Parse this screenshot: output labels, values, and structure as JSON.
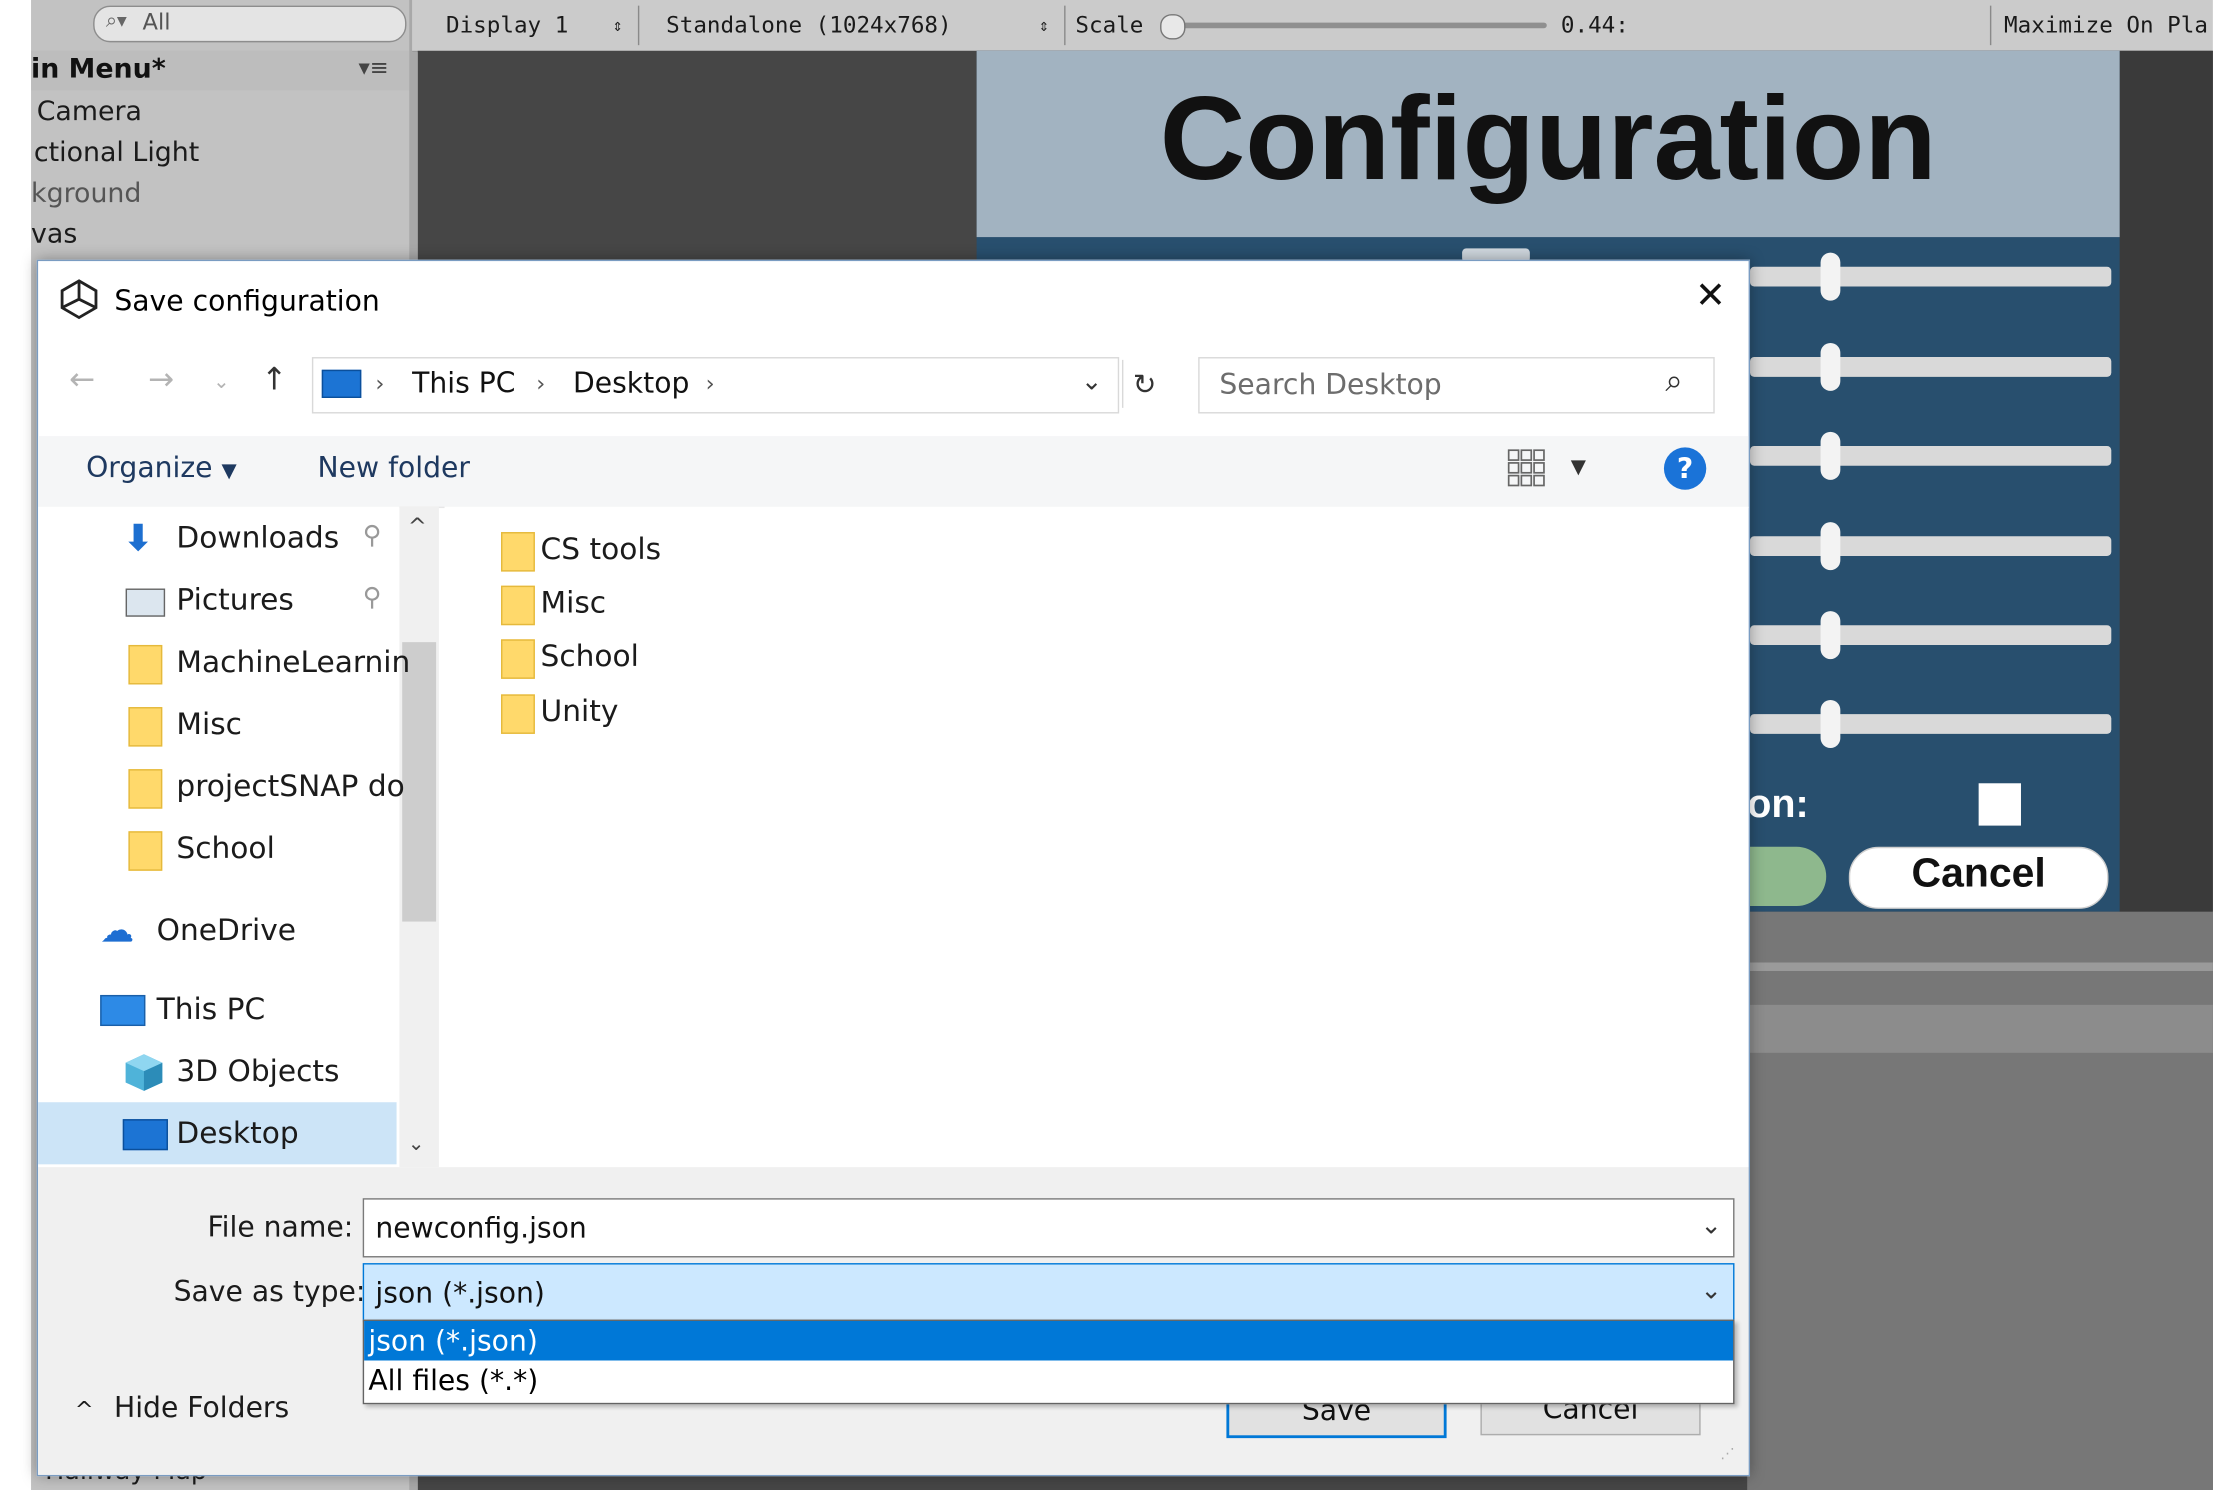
{
  "unity": {
    "search_text": "All",
    "hierarchy_title": "in Menu*",
    "hierarchy_items": [
      "Camera",
      "ctional Light",
      "kground",
      "vas"
    ],
    "hierarchy_bottom": "Hallway Map",
    "toolbar": {
      "display": "Display 1",
      "resolution": "Standalone (1024x768)",
      "scale_label": "Scale",
      "scale_value": "0.44:",
      "scale_fraction": 0.0,
      "maximize": "Maximize On Pla"
    },
    "config_title": "Configuration",
    "config_label": "on:",
    "cancel_label": "Cancel",
    "slider_values": [
      0.22,
      0.22,
      0.22,
      0.22,
      0.22,
      0.22
    ]
  },
  "dialog": {
    "title": "Save configuration",
    "address": {
      "crumbs": [
        "This PC",
        "Desktop"
      ]
    },
    "search_placeholder": "Search Desktop",
    "toolbar": {
      "organize": "Organize",
      "new_folder": "New folder"
    },
    "nav_items": [
      {
        "label": "Downloads",
        "icon": "download-icon",
        "pinned": true
      },
      {
        "label": "Pictures",
        "icon": "pictures-icon",
        "pinned": true
      },
      {
        "label": "MachineLearnin",
        "icon": "folder-icon"
      },
      {
        "label": "Misc",
        "icon": "folder-icon"
      },
      {
        "label": "projectSNAP do",
        "icon": "folder-icon"
      },
      {
        "label": "School",
        "icon": "folder-icon"
      },
      {
        "label": "OneDrive",
        "icon": "onedrive-icon"
      },
      {
        "label": "This PC",
        "icon": "pc-icon"
      },
      {
        "label": "3D Objects",
        "icon": "cube-icon"
      },
      {
        "label": "Desktop",
        "icon": "desktop-icon",
        "selected": true
      }
    ],
    "files": [
      "CS tools",
      "Misc",
      "School",
      "Unity"
    ],
    "file_name_label": "File name:",
    "file_name_value": "newconfig.json",
    "save_type_label": "Save as type:",
    "save_type_value": "json (*.json)",
    "save_type_options": [
      "json (*.json)",
      "All files (*.*)"
    ],
    "save_button": "Save",
    "cancel_button": "Cancel",
    "hide_folders": "Hide Folders",
    "colors": {
      "selection": "#0078d7",
      "nav_selected": "#cce4f7",
      "link_text": "#1b1b1b"
    }
  }
}
